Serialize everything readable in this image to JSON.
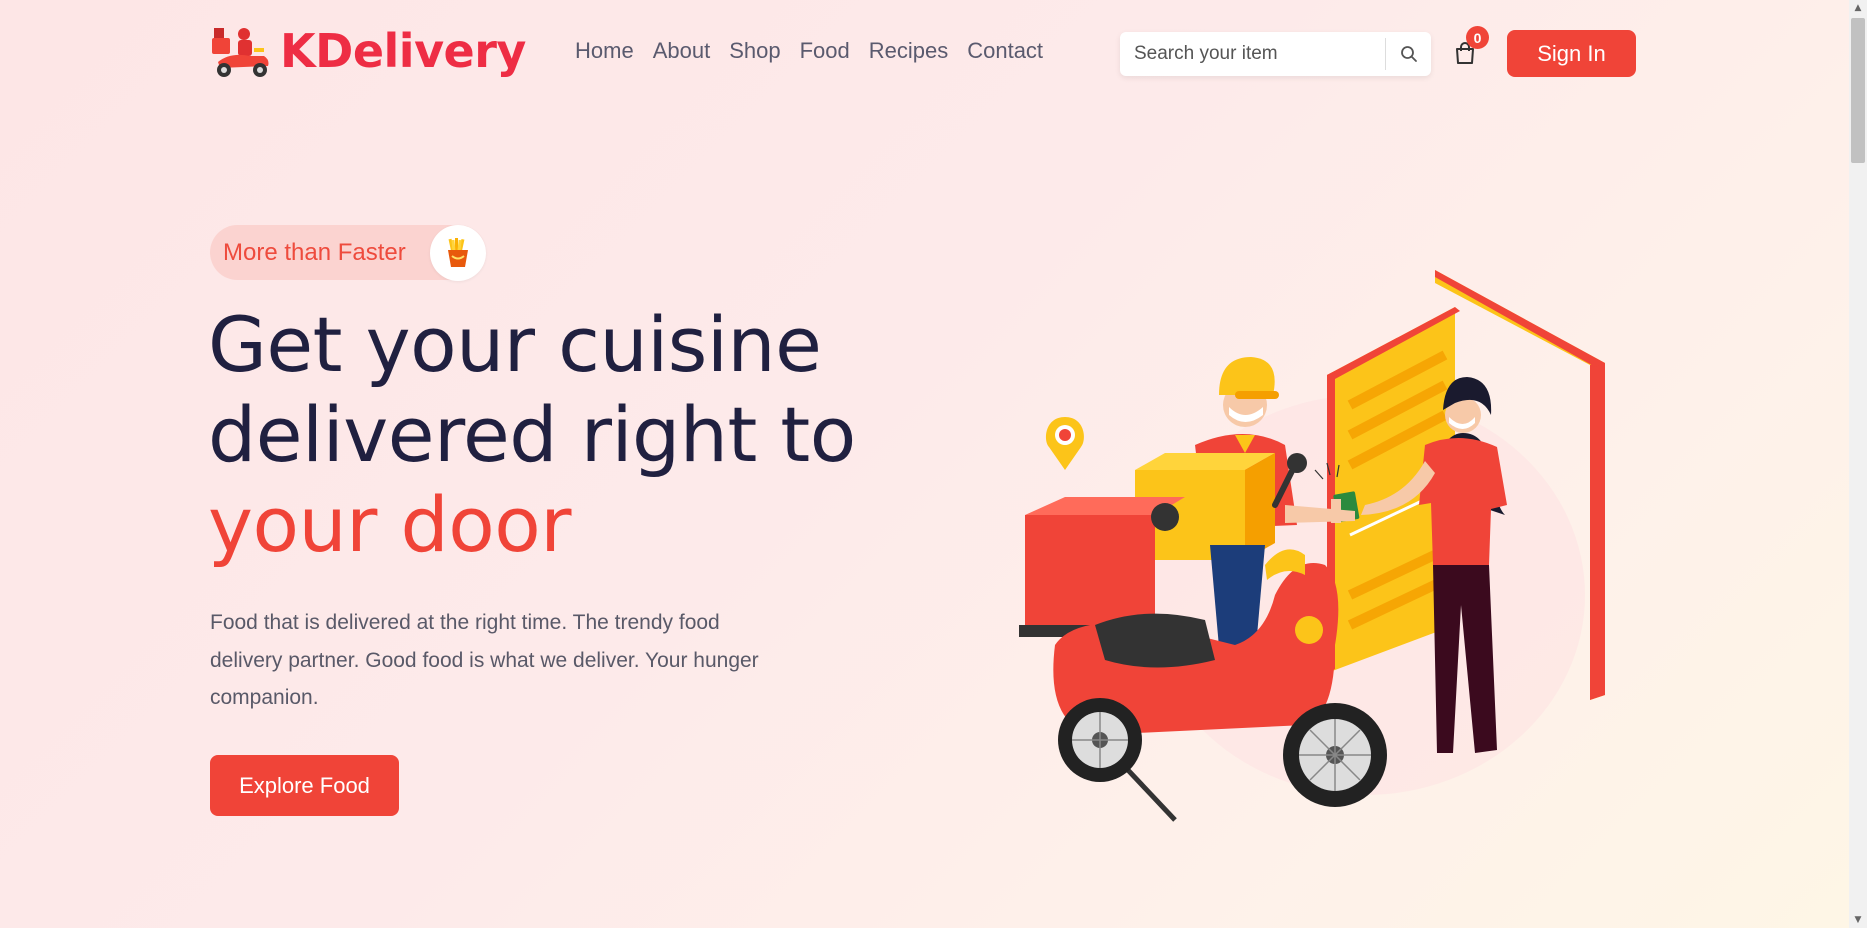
{
  "brand": {
    "name": "KDelivery",
    "logo_icon": "delivery-scooter-icon",
    "color": "#ee2d44"
  },
  "nav": {
    "items": [
      {
        "label": "Home"
      },
      {
        "label": "About"
      },
      {
        "label": "Shop"
      },
      {
        "label": "Food"
      },
      {
        "label": "Recipes"
      },
      {
        "label": "Contact"
      }
    ]
  },
  "search": {
    "placeholder": "Search your item",
    "value": "",
    "icon": "search-icon"
  },
  "cart": {
    "icon": "shopping-bag-icon",
    "count": "0"
  },
  "signin": {
    "label": "Sign In"
  },
  "hero": {
    "badge_text": "More than Faster",
    "badge_icon": "french-fries-icon",
    "headline_line1": "Get your cuisine",
    "headline_line2": "delivered right to",
    "headline_accent": "your door",
    "description": "Food that is delivered at the right time. The trendy food delivery partner. Good food is what we deliver. Your hunger companion.",
    "cta_label": "Explore Food",
    "illustration": "delivery-person-scooter-customer-door-illustration"
  },
  "colors": {
    "accent": "#f04438",
    "heading": "#202040",
    "text": "#595968",
    "yellow": "#fcc419"
  }
}
